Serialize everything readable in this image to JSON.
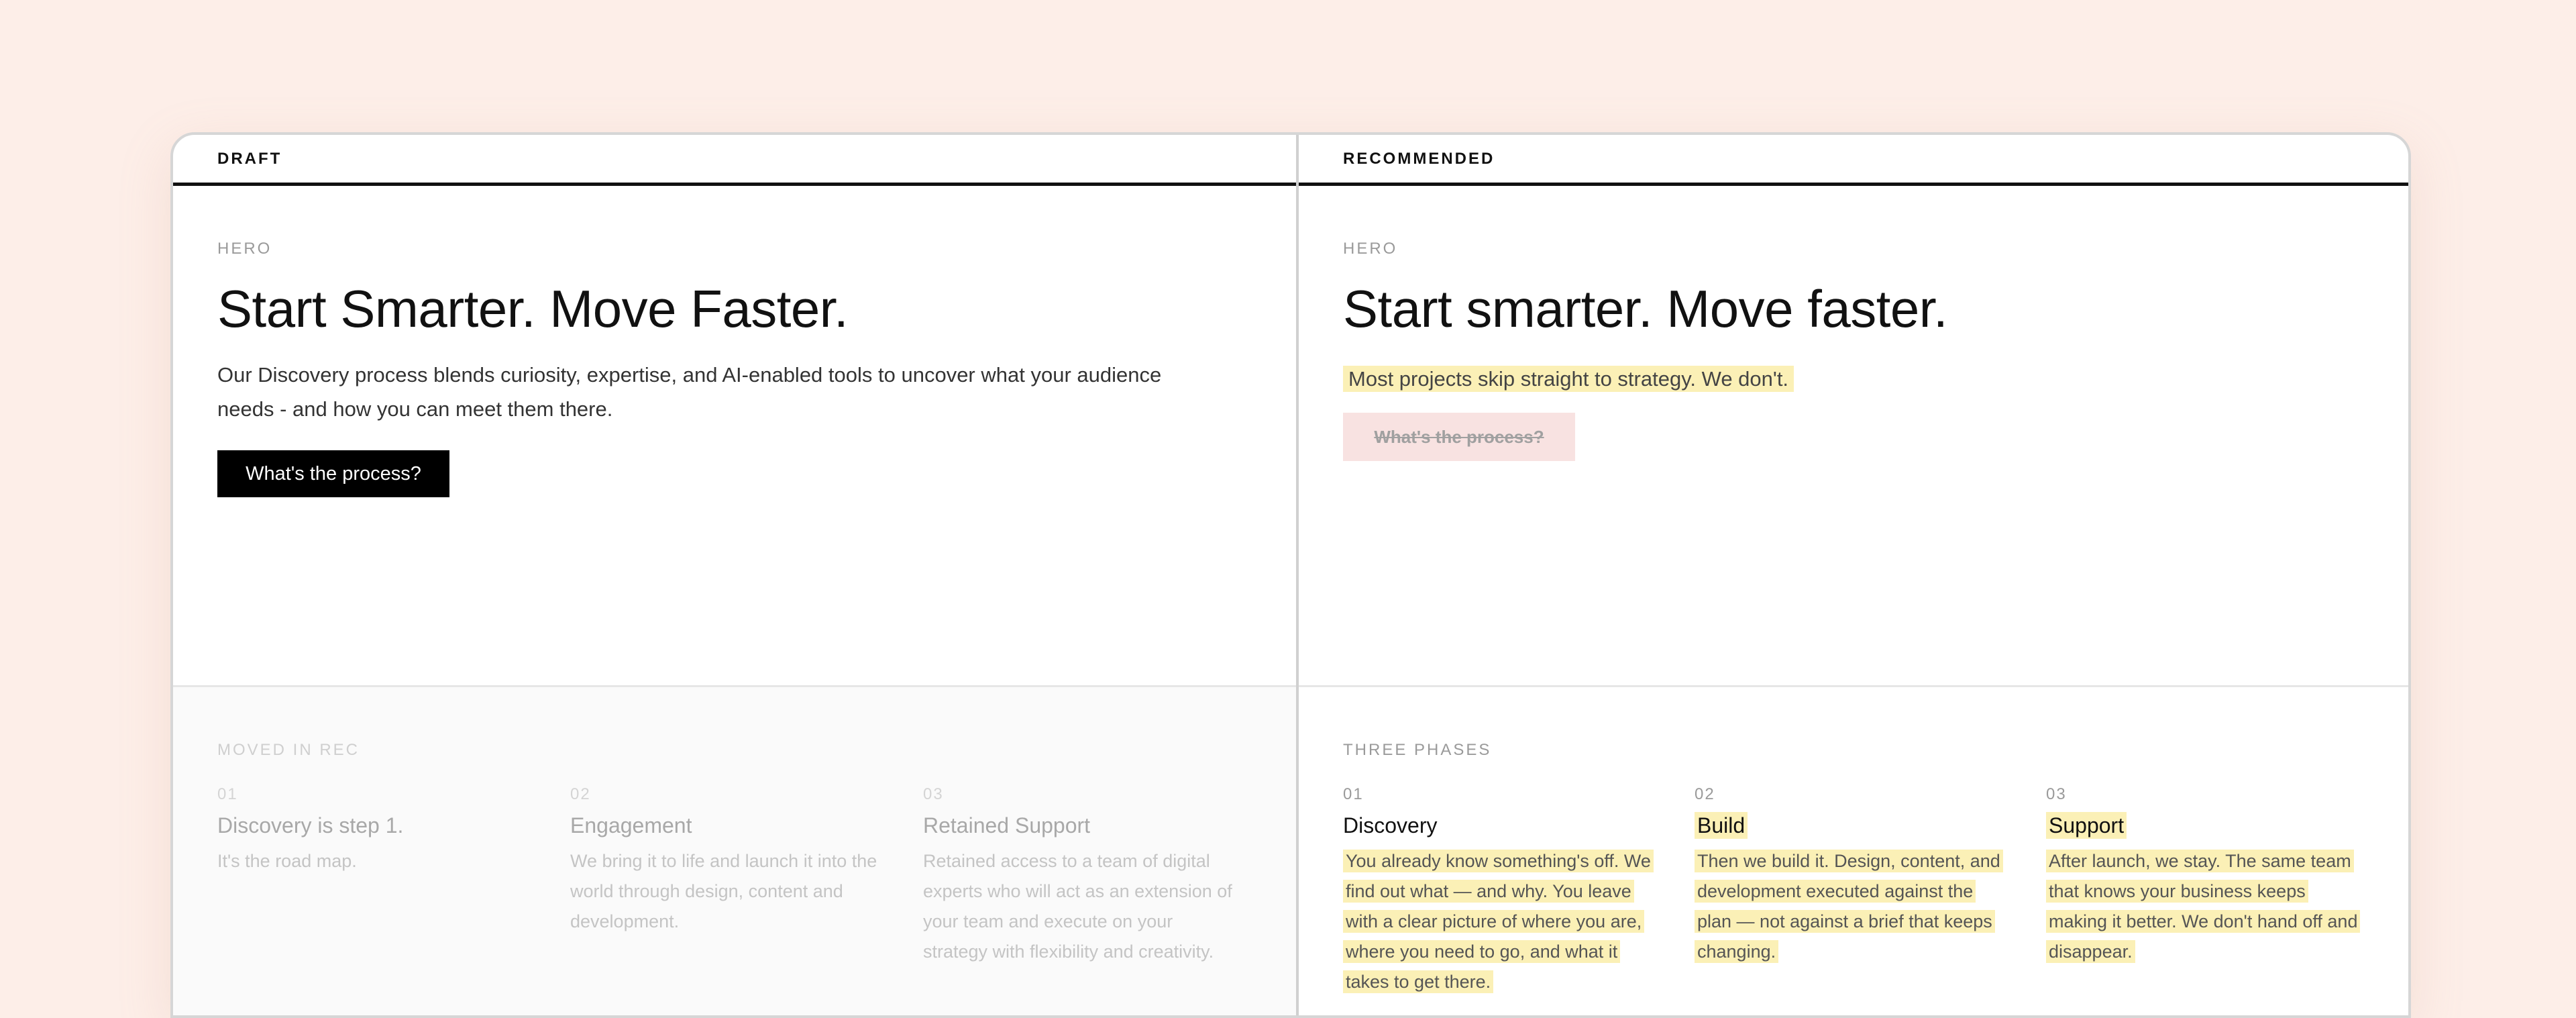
{
  "draft": {
    "header": "DRAFT",
    "hero_label": "HERO",
    "title": "Start Smarter. Move Faster.",
    "lead": "Our Discovery process blends curiosity, expertise, and AI-enabled tools to uncover what your audience needs - and how you can meet them there.",
    "cta": "What's the process?",
    "section_label": "MOVED IN REC",
    "phases": [
      {
        "num": "01",
        "title": "Discovery is step 1.",
        "desc": "It's the road map."
      },
      {
        "num": "02",
        "title": "Engagement",
        "desc": "We bring it to life and launch it into the world through design, content and development."
      },
      {
        "num": "03",
        "title": "Retained Support",
        "desc": "Retained access to a team of digital experts who will act as an extension of your team and execute on your strategy with flexibility and creativity."
      }
    ]
  },
  "recommended": {
    "header": "RECOMMENDED",
    "hero_label": "HERO",
    "title": "Start smarter. Move faster.",
    "lead": "Most projects skip straight to strategy. We don't.",
    "cta_removed": "What's the process?",
    "section_label": "THREE PHASES",
    "phases": [
      {
        "num": "01",
        "title": "Discovery",
        "desc": "You already know something's off. We find out what — and why. You leave with a clear picture of where you are, where you need to go, and what it takes to get there."
      },
      {
        "num": "02",
        "title": "Build",
        "desc": "Then we build it. Design, content, and development executed against the plan — not against a brief that keeps changing."
      },
      {
        "num": "03",
        "title": "Support",
        "desc": "After launch, we stay. The same team that knows your business keeps making it better. We don't hand off and disappear."
      }
    ]
  },
  "colors": {
    "background": "#fdeee8",
    "highlight": "#fbf0b6",
    "removed": "#f8e2e1",
    "button": "#000000"
  }
}
